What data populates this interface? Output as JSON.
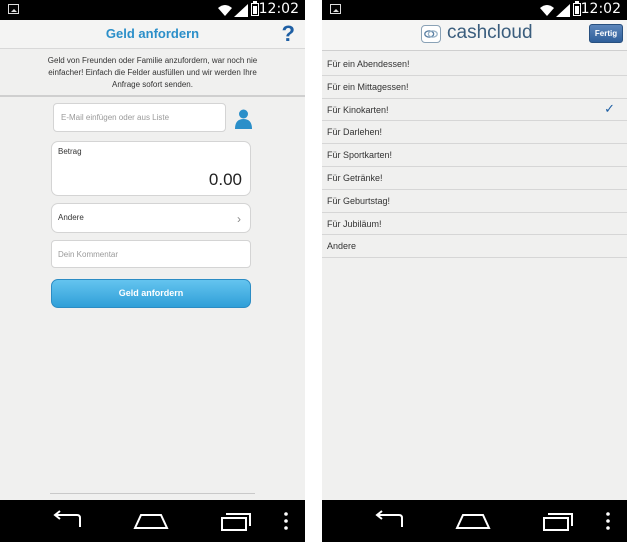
{
  "status": {
    "time": "12:02"
  },
  "request_screen": {
    "title": "Geld anfordern",
    "help_symbol": "?",
    "intro_lines": [
      "Geld von Freunden oder Familie anzufordern, war noch nie",
      "einfacher! Einfach die Felder ausfüllen und wir werden Ihre",
      "Anfrage sofort senden."
    ],
    "email_placeholder": "E-Mail einfügen oder aus Liste",
    "amount_label": "Betrag",
    "amount_value": "0.00",
    "purpose_label": "Andere",
    "comment_placeholder": "Dein Kommentar",
    "submit_label": "Geld anfordern"
  },
  "purpose_screen": {
    "brand": "cashcloud",
    "done_label": "Fertig",
    "options": [
      {
        "label": "Für ein Abendessen!",
        "selected": false
      },
      {
        "label": "Für ein Mittagessen!",
        "selected": false
      },
      {
        "label": "Für Kinokarten!",
        "selected": true
      },
      {
        "label": "Für Darlehen!",
        "selected": false
      },
      {
        "label": "Für Sportkarten!",
        "selected": false
      },
      {
        "label": "Für Getränke!",
        "selected": false
      },
      {
        "label": "Für Geburtstag!",
        "selected": false
      },
      {
        "label": "Für Jubiläum!",
        "selected": false
      },
      {
        "label": "Andere",
        "selected": false
      }
    ],
    "check_symbol": "✓"
  },
  "icons": {
    "status_image": "image-notification-icon",
    "wifi": "wifi-icon",
    "signal": "signal-icon",
    "battery": "battery-icon",
    "back": "back-icon",
    "home": "home-icon",
    "recents": "recents-icon",
    "menu": "overflow-menu-icon",
    "contact": "contact-icon",
    "chevron": "chevron-right-icon",
    "logo": "cashcloud-logo-icon"
  },
  "colors": {
    "title_blue": "#2b8fc9",
    "button_blue": "#3aa9df",
    "done_blue": "#2f5f9a"
  }
}
